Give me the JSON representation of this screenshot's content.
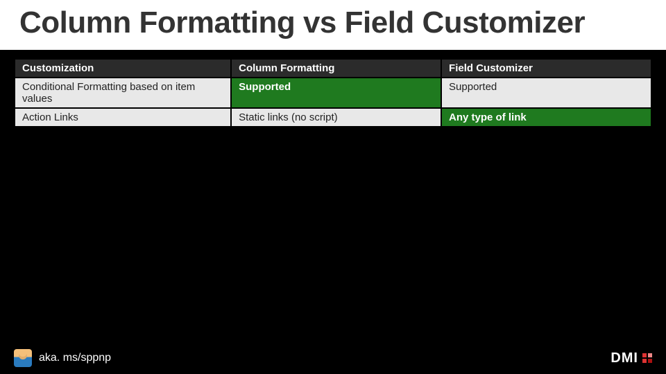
{
  "title": "Column Formatting vs Field Customizer",
  "table": {
    "headers": [
      "Customization",
      "Column Formatting",
      "Field Customizer"
    ],
    "rows": [
      {
        "cells": [
          {
            "text": "Conditional Formatting based on item values",
            "highlight": false
          },
          {
            "text": "Supported",
            "highlight": true
          },
          {
            "text": "Supported",
            "highlight": false
          }
        ]
      },
      {
        "cells": [
          {
            "text": "Action Links",
            "highlight": false
          },
          {
            "text": "Static links (no script)",
            "highlight": false
          },
          {
            "text": "Any type of link",
            "highlight": true
          }
        ]
      }
    ]
  },
  "footer": {
    "link": "aka. ms/sppnp",
    "brand": "DMI"
  },
  "chart_data": {
    "type": "table",
    "title": "Column Formatting vs Field Customizer",
    "headers": [
      "Customization",
      "Column Formatting",
      "Field Customizer"
    ],
    "rows": [
      [
        "Conditional Formatting based on item values",
        "Supported",
        "Supported"
      ],
      [
        "Action Links",
        "Static links (no script)",
        "Any type of link"
      ]
    ]
  }
}
